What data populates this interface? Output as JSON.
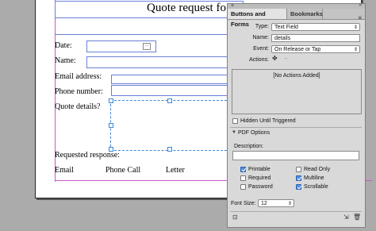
{
  "document": {
    "title": "Quote request fo",
    "fields": {
      "date": "Date:",
      "name": "Name:",
      "email": "Email address:",
      "phone": "Phone number:",
      "details": "Quote details?",
      "requested": "Requested response:",
      "opt_email": "Email",
      "opt_phone": "Phone Call",
      "opt_letter": "Letter"
    }
  },
  "panel": {
    "tabs": [
      "Buttons and Forms",
      "Bookmarks"
    ],
    "type_label": "Type:",
    "type_value": "Text Field",
    "name_label": "Name:",
    "name_value": "details",
    "event_label": "Event:",
    "event_value": "On Release or Tap",
    "actions_label": "Actions:",
    "no_actions": "[No Actions Added]",
    "hidden_until_triggered": "Hidden Until Triggered",
    "pdf_options": "PDF Options",
    "description_label": "Description:",
    "description_value": "",
    "options": [
      {
        "label": "Printable",
        "checked": true
      },
      {
        "label": "Read Only",
        "checked": false
      },
      {
        "label": "Required",
        "checked": false
      },
      {
        "label": "Multiline",
        "checked": true
      },
      {
        "label": "Password",
        "checked": false
      },
      {
        "label": "Scrollable",
        "checked": true
      }
    ],
    "font_size_label": "Font Size:",
    "font_size_value": "12"
  },
  "colors": {
    "selection": "#3d86d8",
    "frame": "#6b7fd6",
    "guide": "#cc55cc"
  }
}
